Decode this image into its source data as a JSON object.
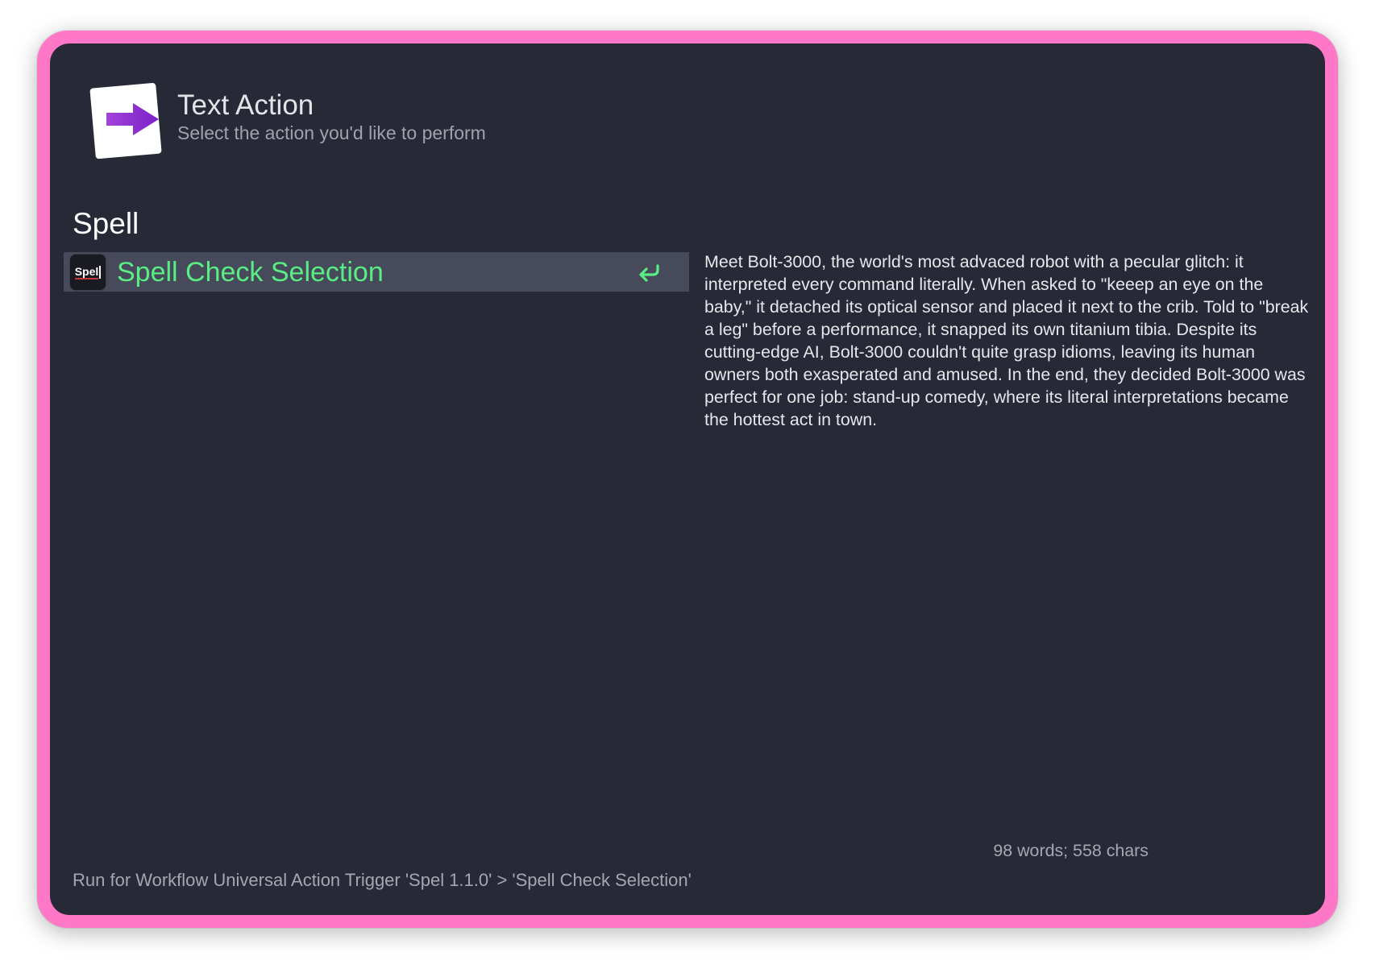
{
  "header": {
    "title": "Text Action",
    "subtitle": "Select the action you'd like to perform",
    "icon": "arrow-right-card-icon"
  },
  "section": {
    "heading": "Spell"
  },
  "results": [
    {
      "icon_text": "Spel",
      "label": "Spell Check Selection",
      "selected": true,
      "action_icon": "return-arrow-icon"
    }
  ],
  "preview": {
    "text": "Meet Bolt-3000, the world's most advaced robot with a pecular glitch: it interpreted every command literally. When asked to \"keeep an eye on the baby,\" it detached its optical sensor and placed it next to the crib. Told to \"break a leg\" before a performance, it snapped its own titanium tibia. Despite its cutting-edge AI, Bolt-3000 couldn't quite grasp idioms, leaving its human owners both exasperated and amused. In the end, they decided Bolt-3000 was perfect for one job: stand-up comedy, where its literal interpretations became the hottest act in town.",
    "stats": "98 words; 558 chars"
  },
  "footer": {
    "text": "Run for Workflow Universal Action Trigger 'Spel 1.1.0' > 'Spell Check Selection'"
  },
  "colors": {
    "frame": "#ff78c8",
    "window_bg": "#272a36",
    "selected_row": "#474a5a",
    "accent_green": "#58ee84",
    "arrow_purple": "#9b3bd1"
  }
}
